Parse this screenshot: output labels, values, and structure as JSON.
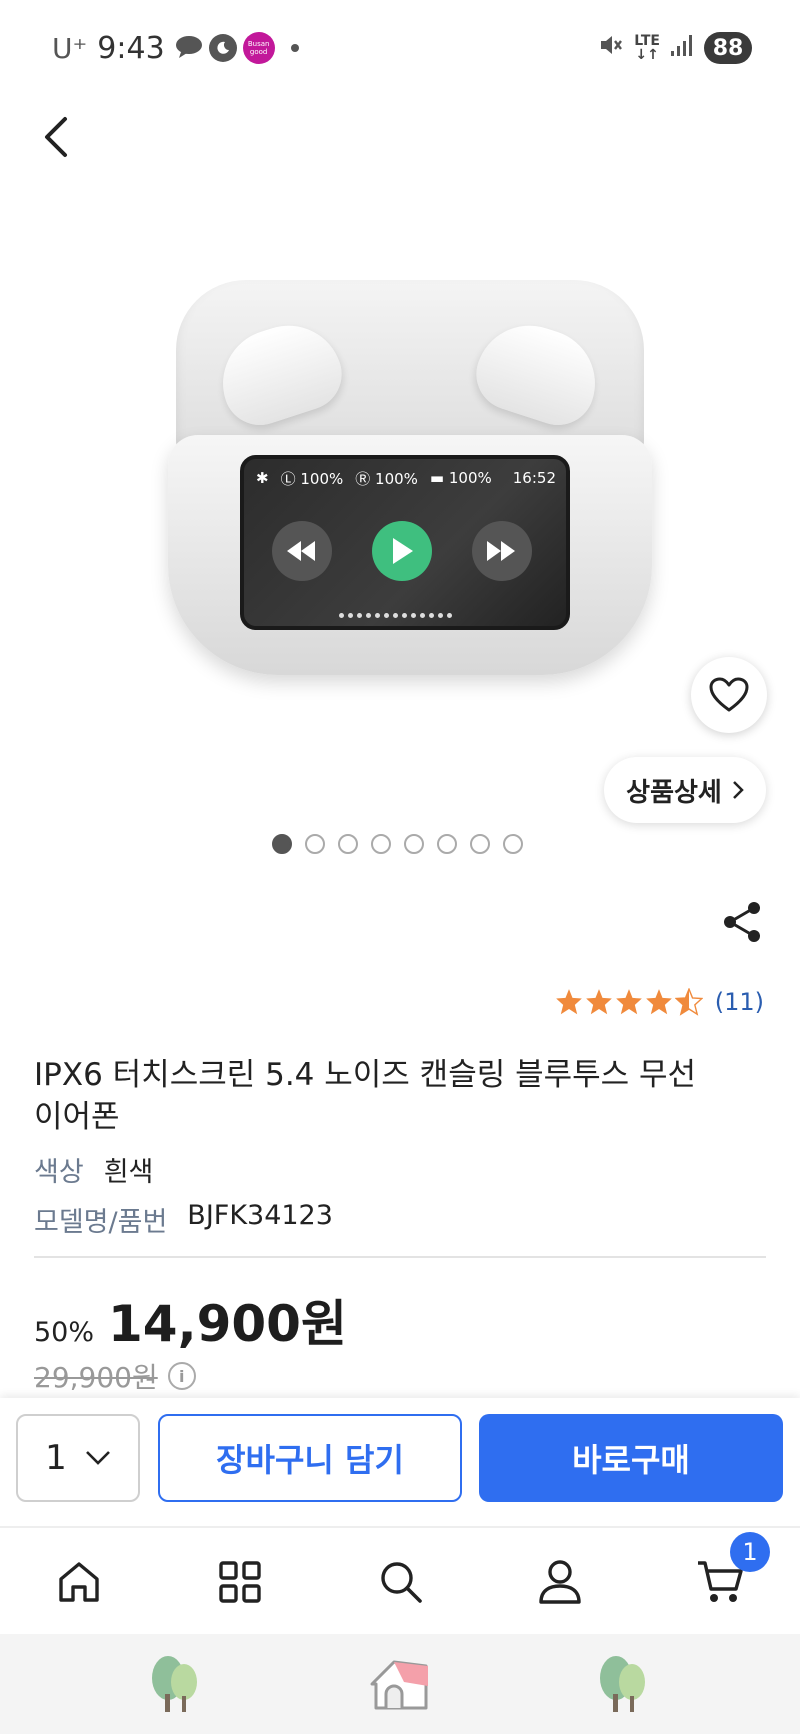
{
  "status_bar": {
    "carrier": "U⁺",
    "time": "9:43",
    "network": "LTE",
    "battery": "88",
    "app_badge": "Busan is good"
  },
  "product": {
    "image_alt": "wireless earbuds with touch screen case",
    "screen": {
      "left": "100%",
      "right": "100%",
      "case": "100%",
      "time": "16:52"
    },
    "detail_button": "상품상세",
    "pager": {
      "count": 8,
      "active": 0
    },
    "rating": {
      "stars": 4.5,
      "count_label": "(11)"
    },
    "title": "IPX6 터치스크린 5.4 노이즈 캔슬링 블루투스 무선 이어폰",
    "attributes": [
      {
        "label": "색상",
        "value": "흰색"
      },
      {
        "label": "모델명/품번",
        "value": "BJFK34123"
      }
    ],
    "discount": "50%",
    "price": "14,900원",
    "original_price": "29,900원"
  },
  "action_bar": {
    "quantity": "1",
    "cart_button": "장바구니 담기",
    "buy_button": "바로구매"
  },
  "bottom_nav": {
    "cart_badge": "1"
  },
  "colors": {
    "accent": "#2f6ef0",
    "star": "#f08a3c",
    "play": "#3fbf7f"
  }
}
